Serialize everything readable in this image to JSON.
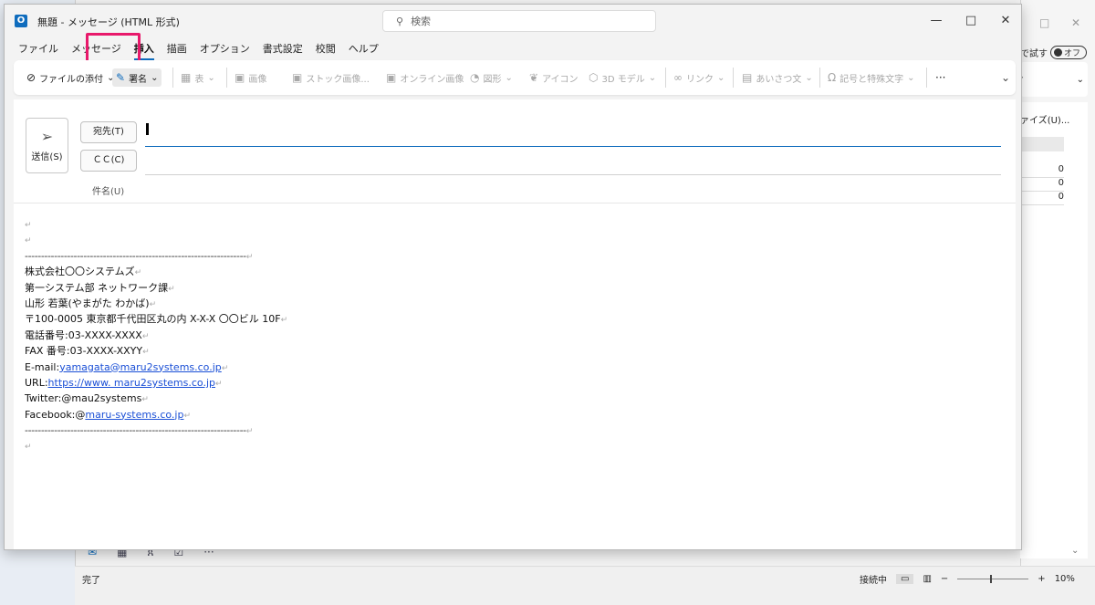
{
  "background": {
    "trial_label": "で試す",
    "toggle_label": "オフ",
    "size_label": "ァイズ(U)...",
    "stats": [
      "0",
      "0",
      "0"
    ],
    "status_left": "完了",
    "status_connection": "接続中",
    "zoom_minus": "−",
    "zoom_plus": "+",
    "zoom_level": "10%"
  },
  "compose": {
    "app_icon": "O",
    "title": "無題 - メッセージ (HTML 形式)",
    "search_placeholder": "検索",
    "window_controls": [
      "—",
      "□",
      "✕"
    ],
    "menu": [
      "ファイル",
      "メッセージ",
      "挿入",
      "描画",
      "オプション",
      "書式設定",
      "校閲",
      "ヘルプ"
    ],
    "active_menu": "挿入",
    "ribbon": {
      "attach": "ファイルの添付",
      "signature": "署名",
      "table": "表",
      "pictures": "画像",
      "stock_images": "ストック画像...",
      "online_pictures": "オンライン画像",
      "shapes": "図形",
      "icons": "アイコン",
      "models_3d": "3D モデル",
      "link": "リンク",
      "greeting": "あいさつ文",
      "symbols": "記号と特殊文字",
      "more": "···"
    },
    "send_label": "送信(S)",
    "to_label": "宛先(T)",
    "cc_label": "ＣＣ(C)",
    "subject_label": "件名(U)"
  },
  "body": {
    "empty1": "",
    "empty2": "",
    "rule_top": "--------------------------------------------------------------------",
    "company": "株式会社〇〇システムズ",
    "department": "第一システム部 ネットワーク課",
    "name": "山形 若葉(やまがた わかば)",
    "address": "〒100-0005 東京都千代田区丸の内 X-X-X 〇〇ビル 10F",
    "phone": "電話番号:03-XXXX-XXXX",
    "fax": "FAX 番号:03-XXXX-XXYY",
    "email_label": "E-mail:",
    "email": "yamagata@maru2systems.co.jp",
    "url_label": "URL:",
    "url": "https://www. maru2systems.co.jp",
    "twitter": "Twitter:@mau2systems",
    "facebook_label": "Facebook:@",
    "facebook": "maru-systems.co.jp",
    "rule_bottom": "--------------------------------------------------------------------",
    "paragraph_mark": "↵"
  }
}
